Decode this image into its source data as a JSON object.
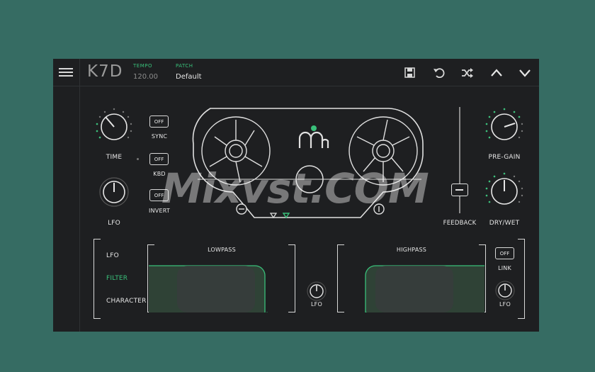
{
  "header": {
    "logo": "K7D",
    "tempo_label": "TEMPO",
    "tempo_value": "120.00",
    "patch_label": "PATCH",
    "patch_value": "Default"
  },
  "left_controls": {
    "time_label": "TIME",
    "lfo_label": "LFO",
    "sync": {
      "label": "SYNC",
      "state": "OFF"
    },
    "kbd": {
      "label": "KBD",
      "state": "OFF"
    },
    "invert": {
      "label": "INVERT",
      "state": "OFF"
    }
  },
  "right_controls": {
    "pre_gain_label": "PRE-GAIN",
    "feedback_label": "FEEDBACK",
    "dry_wet_label": "DRY/WET"
  },
  "bottom": {
    "tabs": [
      "LFO",
      "FILTER",
      "CHARACTER"
    ],
    "active_tab": "FILTER",
    "lowpass_label": "LOWPASS",
    "highpass_label": "HIGHPASS",
    "center_lfo_label": "LFO",
    "right_lfo_label": "LFO",
    "link": {
      "label": "LINK",
      "state": "OFF"
    }
  },
  "colors": {
    "accent": "#39c07a",
    "panel": "#1e1f21",
    "background": "#366c63"
  },
  "watermark": "Mixvst.COM"
}
